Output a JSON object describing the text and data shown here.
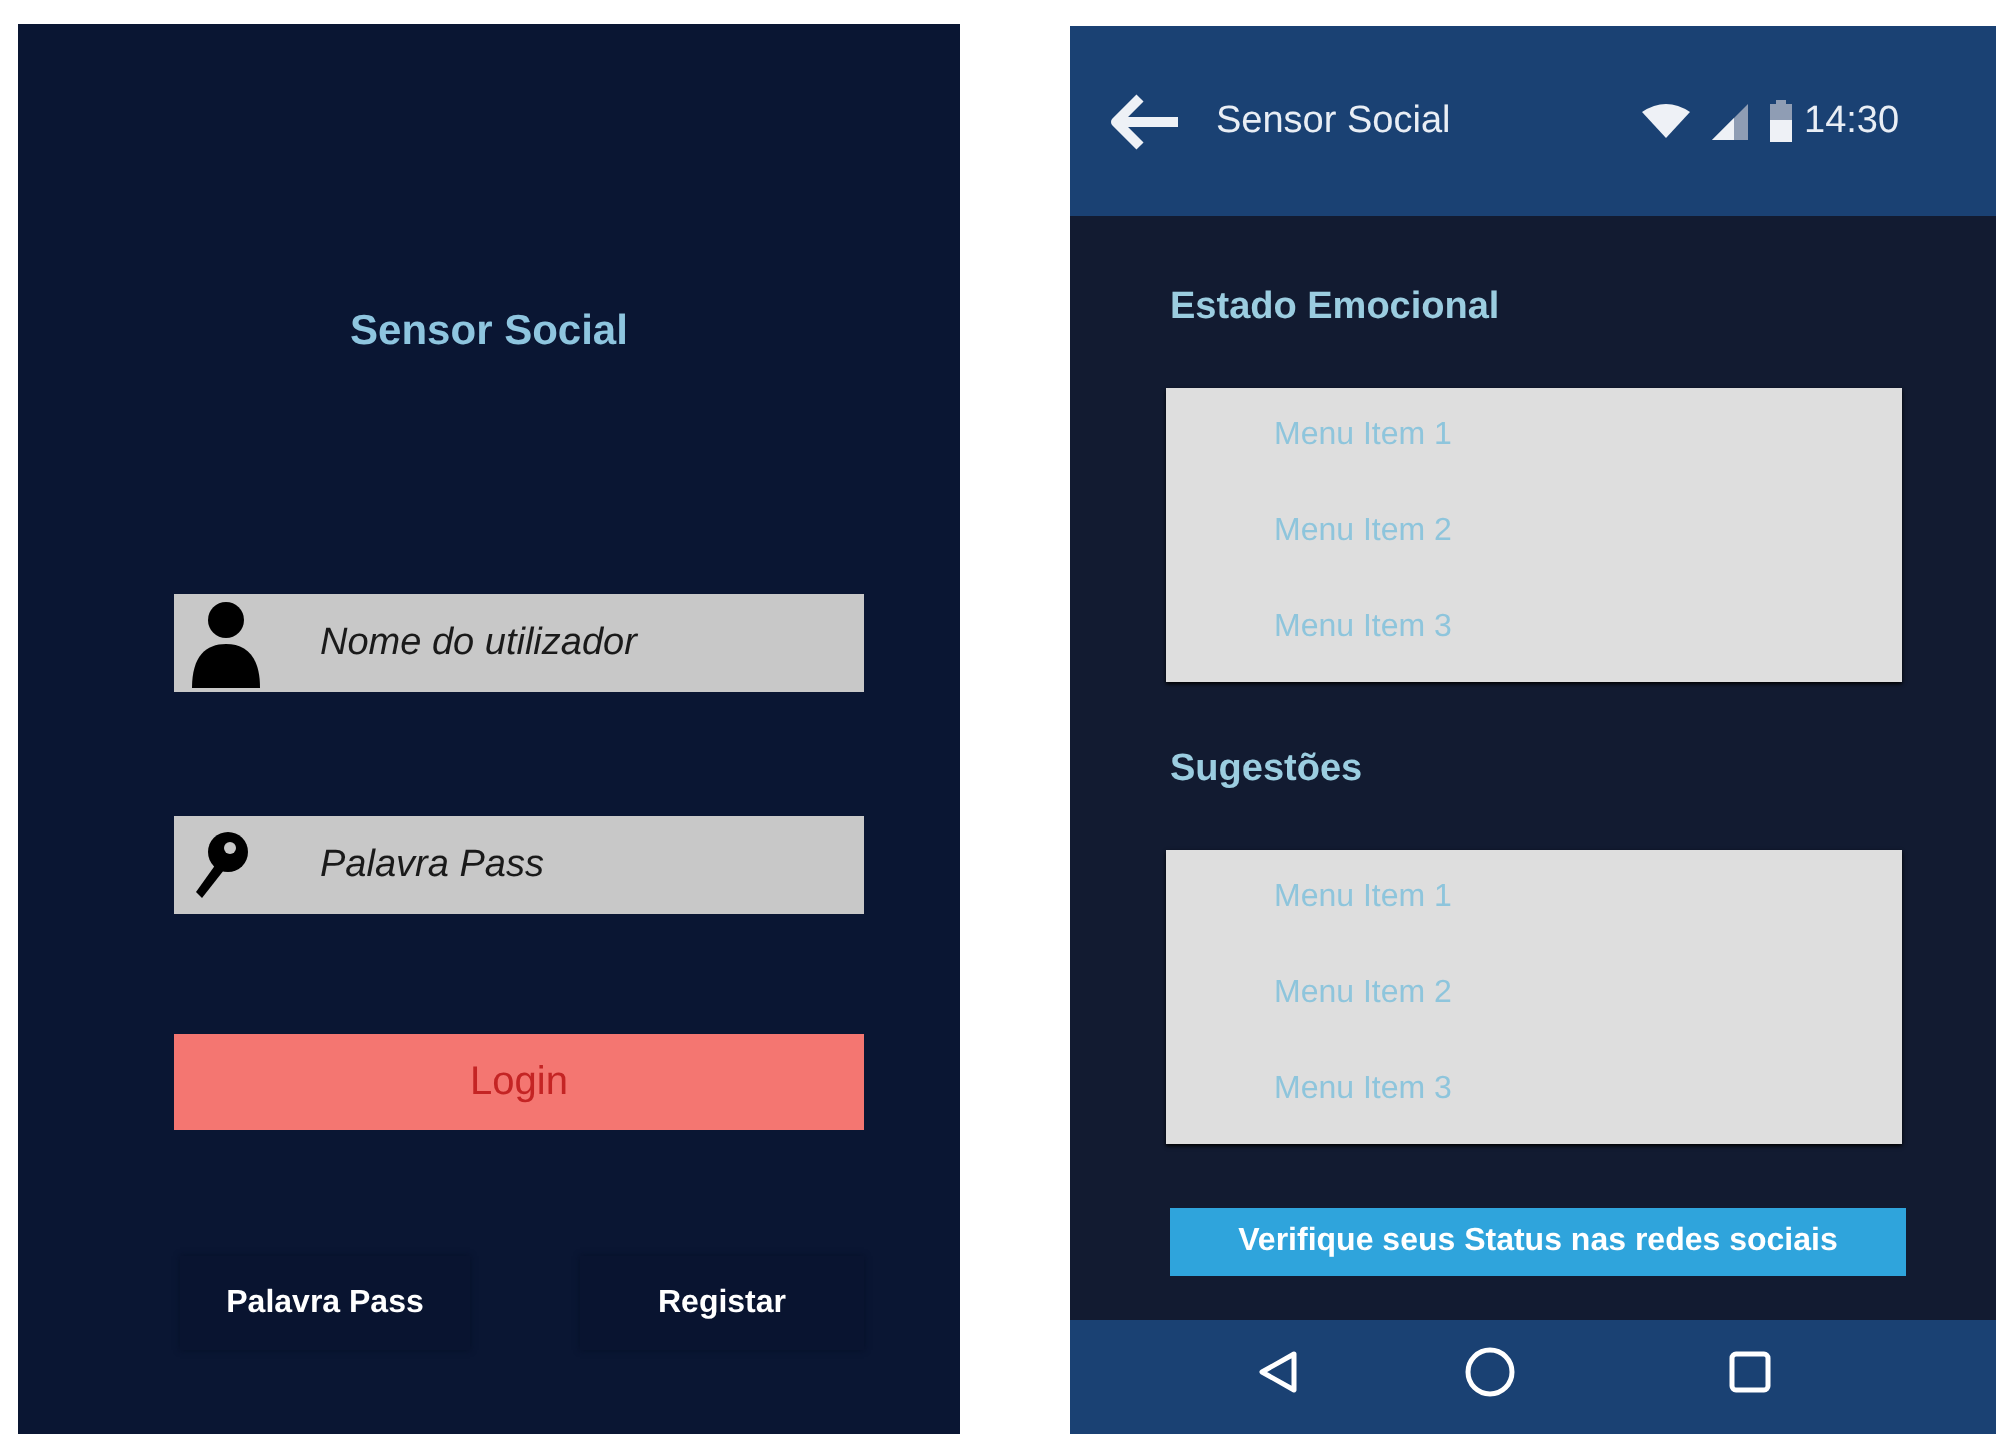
{
  "login_screen": {
    "title": "Sensor Social",
    "fields": [
      {
        "kind": "user",
        "placeholder": "Nome do utilizador"
      },
      {
        "kind": "password",
        "placeholder": "Palavra Pass"
      }
    ],
    "login_button": "Login",
    "links": [
      "Palavra Pass",
      "Registar"
    ]
  },
  "app_screen": {
    "app_bar": {
      "title": "Sensor Social",
      "time": "14:30"
    },
    "sections": [
      {
        "heading": "Estado Emocional",
        "items": [
          "Menu Item 1",
          "Menu Item 2",
          "Menu Item 3"
        ]
      },
      {
        "heading": "Sugestões",
        "items": [
          "Menu Item 1",
          "Menu Item 2",
          "Menu Item 3"
        ]
      }
    ],
    "action_button": "Verifique seus Status nas redes sociais"
  }
}
